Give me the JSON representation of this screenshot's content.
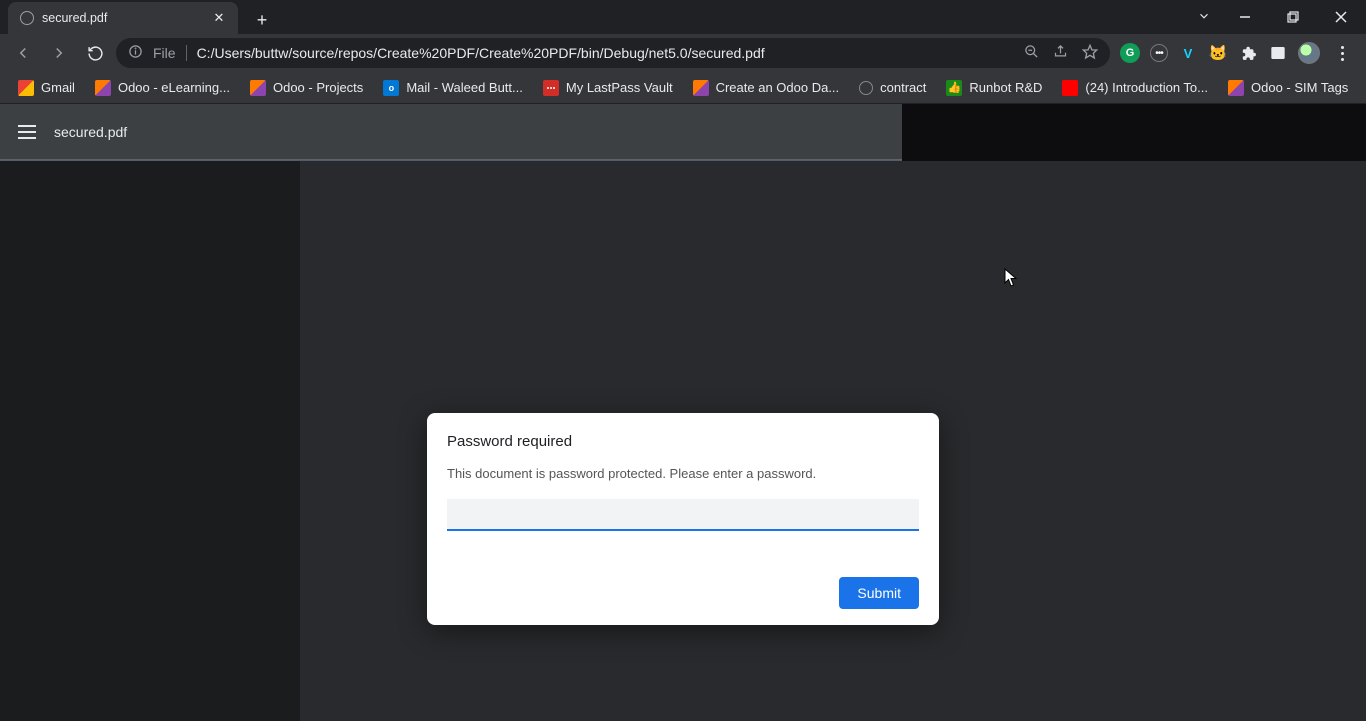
{
  "tab": {
    "title": "secured.pdf"
  },
  "address": {
    "scheme": "File",
    "url": "C:/Users/buttw/source/repos/Create%20PDF/Create%20PDF/bin/Debug/net5.0/secured.pdf"
  },
  "bookmarks": [
    {
      "icon": "gmail",
      "label": "Gmail"
    },
    {
      "icon": "odoo",
      "label": "Odoo - eLearning..."
    },
    {
      "icon": "odoo",
      "label": "Odoo - Projects"
    },
    {
      "icon": "outlook",
      "label": "Mail - Waleed Butt..."
    },
    {
      "icon": "lastpass",
      "label": "My LastPass Vault"
    },
    {
      "icon": "odoo",
      "label": "Create an Odoo Da..."
    },
    {
      "icon": "circle",
      "label": "contract"
    },
    {
      "icon": "runbot",
      "label": "Runbot R&D"
    },
    {
      "icon": "yt",
      "label": "(24) Introduction To..."
    },
    {
      "icon": "odoo",
      "label": "Odoo - SIM Tags"
    }
  ],
  "viewer": {
    "doc_title": "secured.pdf"
  },
  "dialog": {
    "title": "Password required",
    "message": "This document is password protected. Please enter a password.",
    "input_value": "",
    "submit_label": "Submit"
  }
}
